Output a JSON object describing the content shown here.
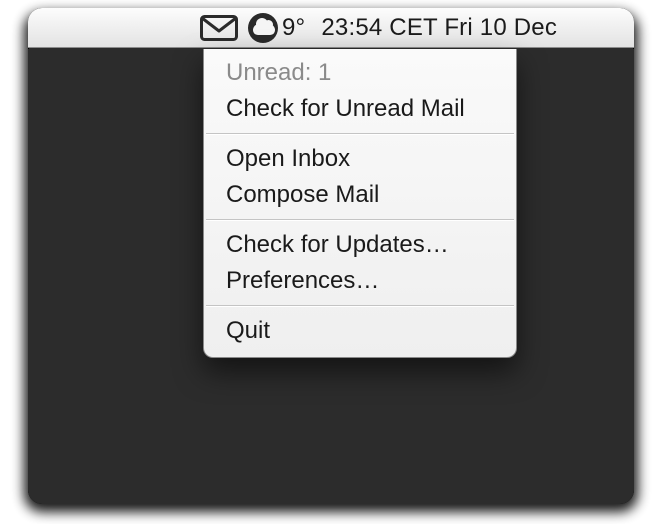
{
  "menubar": {
    "weather_temp": "9°",
    "clock_text": "23:54 CET Fri 10 Dec"
  },
  "menu": {
    "status_unread": "Unread: 1",
    "check_unread": "Check for Unread Mail",
    "open_inbox": "Open Inbox",
    "compose": "Compose Mail",
    "check_updates": "Check for Updates…",
    "preferences": "Preferences…",
    "quit": "Quit"
  }
}
